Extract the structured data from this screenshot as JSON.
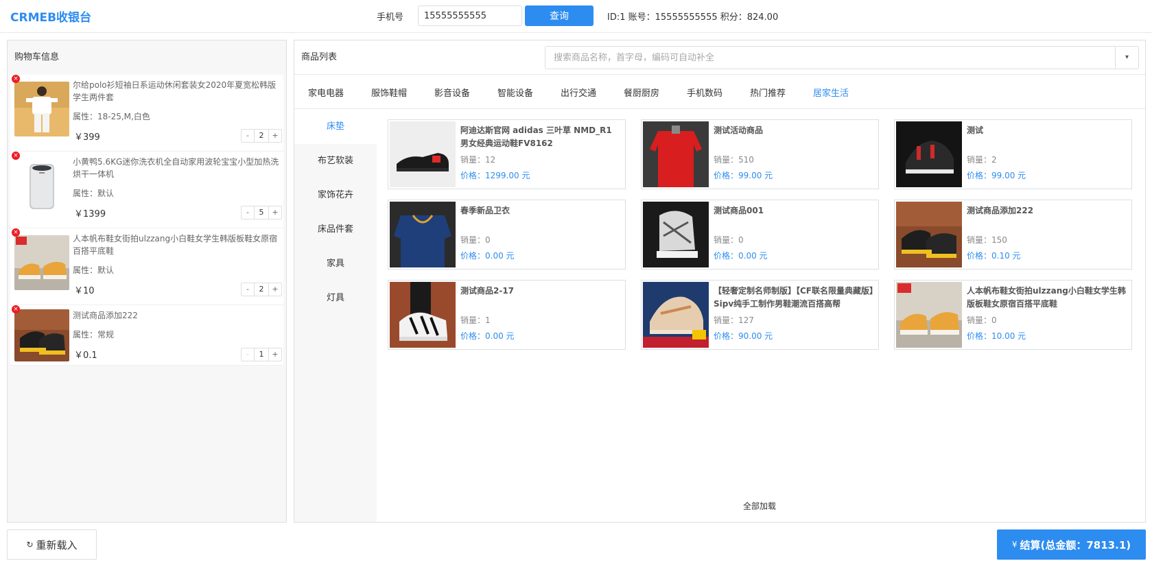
{
  "header": {
    "brand": "CRMEB收银台",
    "phone_label": "手机号",
    "phone_value": "15555555555",
    "query_label": "查询",
    "member_info": "ID:1 账号：15555555555 积分：824.00"
  },
  "cart": {
    "title": "购物车信息",
    "items": [
      {
        "name": "尔给polo衫短袖日系运动休闲套装女2020年夏宽松韩版学生两件套",
        "attr": "属性：18-25,M,白色",
        "price": "￥399",
        "qty": "2",
        "minus": "-",
        "plus": "+",
        "remove": "×",
        "image": "white-outfit"
      },
      {
        "name": "小黄鸭5.6KG迷你洗衣机全自动家用波轮宝宝小型加热洗烘干一体机",
        "attr": "属性：默认",
        "price": "￥1399",
        "qty": "5",
        "minus": "-",
        "plus": "+",
        "remove": "×",
        "image": "washing-machine"
      },
      {
        "name": "人本帆布鞋女街拍ulzzang小白鞋女学生韩版板鞋女原宿百搭平底鞋",
        "attr": "属性：默认",
        "price": "￥10",
        "qty": "2",
        "minus": "-",
        "plus": "+",
        "remove": "×",
        "image": "canvas-shoes"
      },
      {
        "name": "测试商品添加222",
        "attr": "属性：常规",
        "price": "￥0.1",
        "qty": "1",
        "minus": "-",
        "plus": "+",
        "remove": "×",
        "image": "black-sneakers"
      }
    ]
  },
  "goods": {
    "title": "商品列表",
    "search_placeholder": "搜索商品名称，首字母，编码可自动补全",
    "dropdown_icon": "▾",
    "categories": [
      "家电电器",
      "服饰鞋帽",
      "影音设备",
      "智能设备",
      "出行交通",
      "餐厨厨房",
      "手机数码",
      "热门推荐",
      "居家生活"
    ],
    "active_category": "居家生活",
    "subcategories": [
      "床垫",
      "布艺软装",
      "家饰花卉",
      "床品件套",
      "家具",
      "灯具"
    ],
    "active_subcategory": "床垫",
    "products": [
      {
        "name": "阿迪达斯官网 adidas 三叶草 NMD_R1 男女经典运动鞋FV8162",
        "sales": "销量：12",
        "price": "价格：1299.00 元",
        "image": "adidas-shoe"
      },
      {
        "name": "测试活动商品",
        "sales": "销量：510",
        "price": "价格：99.00 元",
        "image": "red-hoodie"
      },
      {
        "name": "测试",
        "sales": "销量：2",
        "price": "价格：99.00 元",
        "image": "black-red-sneaker"
      },
      {
        "name": "春季新品卫衣",
        "sales": "销量：0",
        "price": "价格：0.00 元",
        "image": "blue-hoodie"
      },
      {
        "name": "测试商品001",
        "sales": "销量：0",
        "price": "价格：0.00 元",
        "image": "white-black-sneaker"
      },
      {
        "name": "测试商品添加222",
        "sales": "销量：150",
        "price": "价格：0.10 元",
        "image": "black-sneakers"
      },
      {
        "name": "测试商品2-17",
        "sales": "销量：1",
        "price": "价格：0.00 元",
        "image": "striped-sneaker"
      },
      {
        "name": "【轻奢定制名师制版】【CF联名限量典藏版】Sipv纯手工制作男鞋潮流百搭高帮",
        "sales": "销量：127",
        "price": "价格：90.00 元",
        "image": "beige-sneaker"
      },
      {
        "name": "人本帆布鞋女街拍ulzzang小白鞋女学生韩版板鞋女原宿百搭平底鞋",
        "sales": "销量：0",
        "price": "价格：10.00 元",
        "image": "canvas-shoes"
      }
    ],
    "load_all": "全部加载"
  },
  "footer": {
    "reload_label": "重新载入",
    "reload_icon": "↻",
    "settle_label": "结算(总金额：7813.1)",
    "settle_icon": "¥"
  },
  "colors": {
    "primary": "#2d8cf0",
    "remove": "#ed1c24",
    "panel_bg": "#f7f7f7",
    "border": "#dcdee2"
  }
}
